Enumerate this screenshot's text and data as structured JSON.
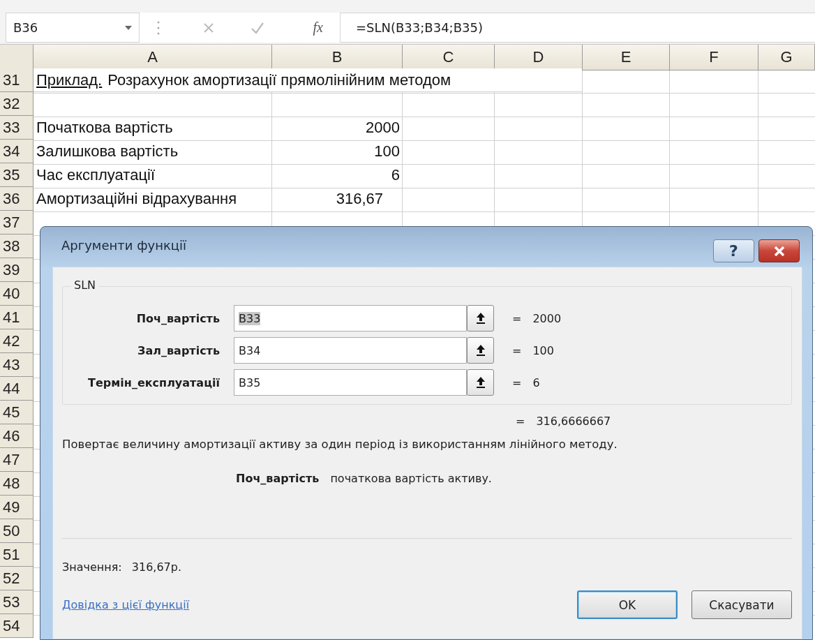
{
  "formula_bar": {
    "name_box": "B36",
    "fx_label": "fx",
    "formula": "=SLN(B33;B34;B35)"
  },
  "sheet": {
    "columns": [
      "A",
      "B",
      "C",
      "D",
      "E",
      "F",
      "G"
    ],
    "rows": [
      {
        "number": "31",
        "cells": [
          {
            "kind": "title",
            "label": "Приклад.",
            "text": "Розрахунок амортизації прямолінійним методом"
          }
        ]
      },
      {
        "number": "32",
        "cells": []
      },
      {
        "number": "33",
        "cells": [
          {
            "kind": "text",
            "text": "Початкова вартість"
          },
          {
            "kind": "number",
            "text": "2000"
          }
        ]
      },
      {
        "number": "34",
        "cells": [
          {
            "kind": "text",
            "text": "Залишкова вартість"
          },
          {
            "kind": "number",
            "text": "100"
          }
        ]
      },
      {
        "number": "35",
        "cells": [
          {
            "kind": "text",
            "text": "Час експлуатації"
          },
          {
            "kind": "number",
            "text": "6"
          }
        ]
      },
      {
        "number": "36",
        "cells": [
          {
            "kind": "text",
            "text": "Амортизаційні відрахування"
          },
          {
            "kind": "currency",
            "text": "316,67"
          }
        ]
      },
      {
        "number": "37",
        "cells": []
      },
      {
        "number": "38",
        "cells": []
      },
      {
        "number": "39",
        "cells": []
      },
      {
        "number": "40",
        "cells": []
      },
      {
        "number": "41",
        "cells": []
      },
      {
        "number": "42",
        "cells": []
      },
      {
        "number": "43",
        "cells": []
      },
      {
        "number": "44",
        "cells": []
      },
      {
        "number": "45",
        "cells": []
      },
      {
        "number": "46",
        "cells": []
      },
      {
        "number": "47",
        "cells": []
      },
      {
        "number": "48",
        "cells": []
      },
      {
        "number": "49",
        "cells": []
      },
      {
        "number": "50",
        "cells": []
      },
      {
        "number": "51",
        "cells": []
      },
      {
        "number": "52",
        "cells": []
      },
      {
        "number": "53",
        "cells": []
      },
      {
        "number": "54",
        "cells": []
      }
    ]
  },
  "dialog": {
    "title": "Аргументи функції",
    "help_button": "?",
    "function_name": "SLN",
    "arguments": [
      {
        "label": "Поч_вартість",
        "value": "B33",
        "highlighted": true,
        "equals": "=",
        "result": "2000"
      },
      {
        "label": "Зал_вартість",
        "value": "B34",
        "highlighted": false,
        "equals": "=",
        "result": "100"
      },
      {
        "label": "Термін_експлуатації",
        "value": "B35",
        "highlighted": false,
        "equals": "=",
        "result": "6"
      }
    ],
    "result": {
      "equals": "=",
      "value": "316,6666667"
    },
    "description": "Повертає величину амортизації активу за один період із використанням лінійного методу.",
    "argument_help": {
      "name": "Поч_вартість",
      "text": "початкова вартість активу."
    },
    "value_label": "Значення:",
    "value": "316,67р.",
    "help_link": "Довідка з цієї функції",
    "buttons": [
      {
        "label": "OK",
        "default": true
      },
      {
        "label": "Скасувати",
        "default": false
      }
    ]
  }
}
